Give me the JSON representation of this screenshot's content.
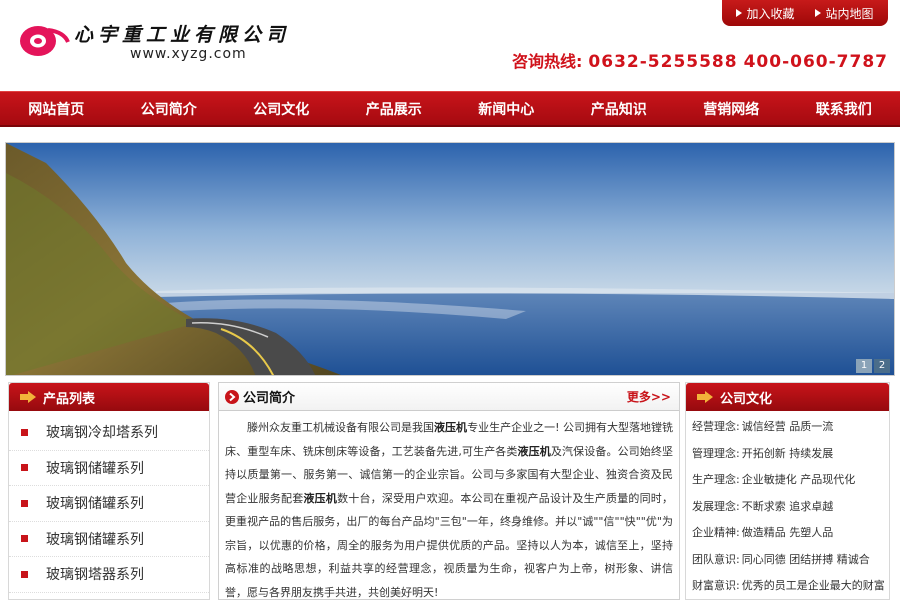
{
  "header": {
    "logo_text": "心宇重工业有限公司",
    "logo_url": "www.xyzg.com",
    "top_links": [
      "加入收藏",
      "站内地图"
    ],
    "hotline_label": "咨询热线:",
    "hotline_numbers": [
      "0632-5255588",
      "400-060-7787"
    ]
  },
  "nav": {
    "items": [
      "网站首页",
      "公司简介",
      "公司文化",
      "产品展示",
      "新闻中心",
      "产品知识",
      "营销网络",
      "联系我们"
    ]
  },
  "banner": {
    "controls": [
      "1",
      "2"
    ],
    "active_index": 0
  },
  "products": {
    "title": "产品列表",
    "items": [
      "玻璃钢冷却塔系列",
      "玻璃钢储罐系列",
      "玻璃钢储罐系列",
      "玻璃钢储罐系列",
      "玻璃钢塔器系列"
    ]
  },
  "intro": {
    "title": "公司简介",
    "more": "更多>>",
    "seg1": "滕州众友重工机械设备有限公司是我国",
    "kw1": "液压机",
    "seg2": "专业生产企业之一! 公司拥有大型落地镗铣床、重型车床、铣床刨床等设备，工艺装备先进,可生产各类",
    "kw2": "液压机",
    "seg3": "及汽保设备。公司始终坚持以质量第一、服务第一、诚信第一的企业宗旨。公司与多家国有大型企业、独资合资及民营企业服务配套",
    "kw3": "液压机",
    "seg4": "数十台，深受用户欢迎。本公司在重视产品设计及生产质量的同时，更重视产品的售后服务，出厂的每台产品均\"三包\"一年，终身维修。并以\"诚\"\"信\"\"快\"\"优\"为宗旨，以优惠的价格，周全的服务为用户提供优质的产品。坚持以人为本，诚信至上，坚持高标准的战略思想，利益共享的经营理念，视质量为生命，视客户为上帝，树形象、讲信誉，愿与各界朋友携手共进，共创美好明天!"
  },
  "culture": {
    "title": "公司文化",
    "rows": [
      {
        "k": "经营理念:",
        "v": "诚信经营 品质一流"
      },
      {
        "k": "管理理念:",
        "v": "开拓创新 持续发展"
      },
      {
        "k": "生产理念:",
        "v": "企业敏捷化 产品现代化"
      },
      {
        "k": "发展理念:",
        "v": "不断求索 追求卓越"
      },
      {
        "k": "企业精神:",
        "v": "做造精品 先塑人品"
      },
      {
        "k": "团队意识:",
        "v": "同心同德 团结拼搏 精诚合"
      },
      {
        "k": "财富意识:",
        "v": "优秀的员工是企业最大的财富"
      }
    ]
  },
  "colors": {
    "brand_red": "#c8141a",
    "hotline_red": "#d0121b",
    "logo_pink": "#e4145a"
  }
}
